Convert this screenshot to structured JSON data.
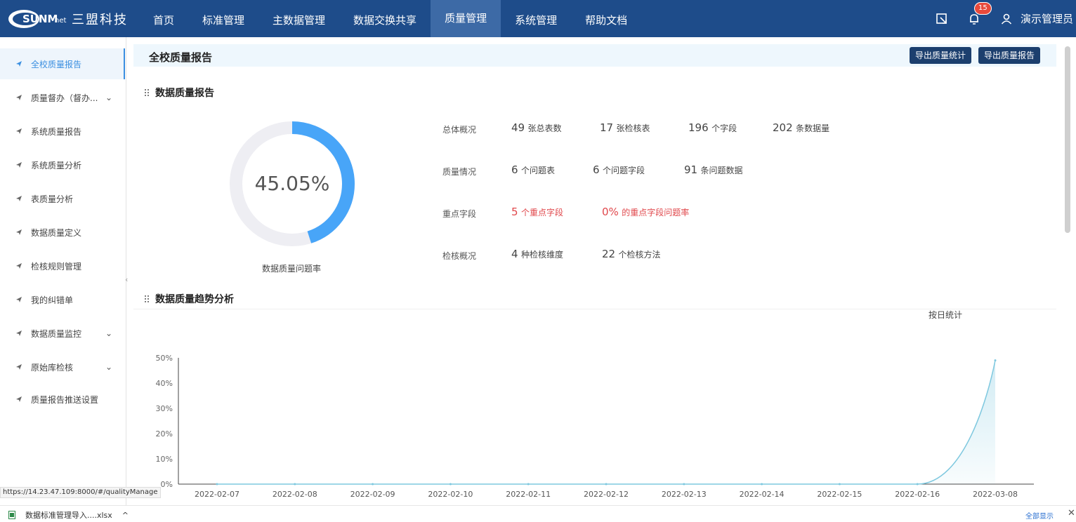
{
  "brand": {
    "logo_text": "三盟科技"
  },
  "nav": {
    "items": [
      "首页",
      "标准管理",
      "主数据管理",
      "数据交换共享",
      "质量管理",
      "系统管理",
      "帮助文档"
    ],
    "active_index": 4,
    "notification_count": "15",
    "user_name": "演示管理员"
  },
  "sidebar": {
    "items": [
      {
        "label": "全校质量报告",
        "active": true,
        "has_chevron": false
      },
      {
        "label": "质量督办（督办...",
        "active": false,
        "has_chevron": true
      },
      {
        "label": "系统质量报告",
        "active": false,
        "has_chevron": false
      },
      {
        "label": "系统质量分析",
        "active": false,
        "has_chevron": false
      },
      {
        "label": "表质量分析",
        "active": false,
        "has_chevron": false
      },
      {
        "label": "数据质量定义",
        "active": false,
        "has_chevron": false
      },
      {
        "label": "检核规则管理",
        "active": false,
        "has_chevron": false
      },
      {
        "label": "我的纠错单",
        "active": false,
        "has_chevron": false
      },
      {
        "label": "数据质量监控",
        "active": false,
        "has_chevron": true
      },
      {
        "label": "原始库检核",
        "active": false,
        "has_chevron": true
      },
      {
        "label": "质量报告推送设置",
        "active": false,
        "has_chevron": false
      }
    ]
  },
  "page": {
    "title": "全校质量报告",
    "export_stats_label": "导出质量统计",
    "export_report_label": "导出质量报告"
  },
  "report": {
    "section_title": "数据质量报告",
    "donut_value": "45.05%",
    "donut_fraction": 0.4505,
    "donut_caption": "数据质量问题率",
    "rows": [
      {
        "label": "总体概况",
        "items": [
          {
            "num": "49",
            "unit": "张总表数",
            "red": false
          },
          {
            "num": "17",
            "unit": "张检核表",
            "red": false
          },
          {
            "num": "196",
            "unit": "个字段",
            "red": false
          },
          {
            "num": "202",
            "unit": "条数据量",
            "red": false
          }
        ]
      },
      {
        "label": "质量情况",
        "items": [
          {
            "num": "6",
            "unit": "个问题表",
            "red": false
          },
          {
            "num": "6",
            "unit": "个问题字段",
            "red": false
          },
          {
            "num": "91",
            "unit": "条问题数据",
            "red": false
          }
        ]
      },
      {
        "label": "重点字段",
        "items": [
          {
            "num": "5",
            "unit": "个重点字段",
            "red": true
          },
          {
            "num": "0%",
            "unit": "的重点字段问题率",
            "red": true
          }
        ]
      },
      {
        "label": "检核概况",
        "items": [
          {
            "num": "4",
            "unit": "种检核维度",
            "red": false
          },
          {
            "num": "22",
            "unit": "个检核方法",
            "red": false
          }
        ]
      }
    ]
  },
  "trend": {
    "section_title": "数据质量趋势分析",
    "by_day_label": "按日统计"
  },
  "chart_data": {
    "type": "area",
    "x": [
      "2022-02-07",
      "2022-02-08",
      "2022-02-09",
      "2022-02-10",
      "2022-02-11",
      "2022-02-12",
      "2022-02-13",
      "2022-02-14",
      "2022-02-15",
      "2022-02-16",
      "2022-03-08"
    ],
    "series": [
      {
        "values": [
          0,
          0,
          0,
          0,
          0,
          0,
          0,
          0,
          0,
          0,
          49
        ]
      }
    ],
    "y_ticks": [
      "0%",
      "10%",
      "20%",
      "30%",
      "40%",
      "50%"
    ],
    "ylim": [
      0,
      50
    ],
    "line_color": "#7ec8df"
  },
  "statusbar": {
    "url": "https://14.23.47.109:8000/#/qualityManage",
    "download_file": "数据标准管理导入....xlsx",
    "show_all": "全部显示"
  }
}
